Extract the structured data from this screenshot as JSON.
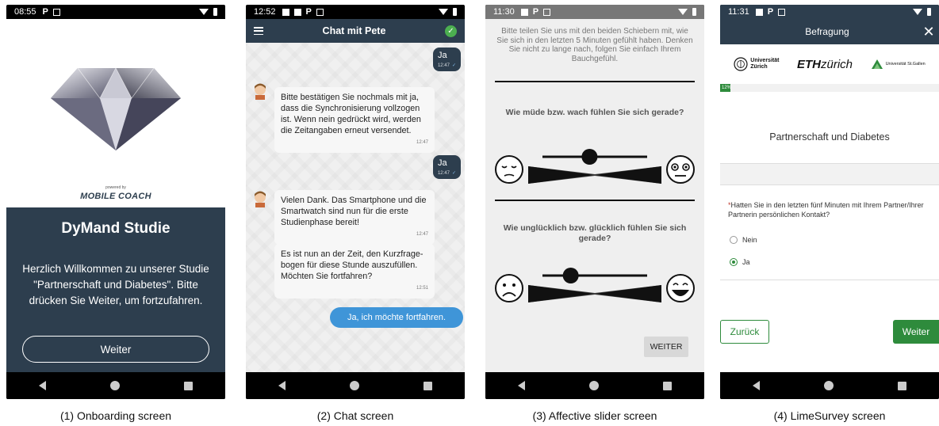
{
  "captions": [
    "(1) Onboarding screen",
    "(2) Chat screen",
    "(3) Affective slider screen",
    "(4) LimeSurvey screen"
  ],
  "onboarding": {
    "status_time": "08:55",
    "powered_by": "powered by",
    "brand": "MOBILE COACH",
    "app_title": "DyMand Studie",
    "welcome_text": "Herzlich Willkommen zu unserer Studie \"Partnerschaft und Diabetes\". Bitte drücken Sie Weiter, um fortzufahren.",
    "weiter_label": "Weiter"
  },
  "chat": {
    "status_time": "12:52",
    "title": "Chat mit Pete",
    "messages": [
      {
        "from": "user",
        "text": "Ja",
        "time": "12:47"
      },
      {
        "from": "coach",
        "text": "Bitte bestätigen Sie nochmals mit ja, dass die Synchronisierung vollzogen ist. Wenn nein gedrückt wird, werden die Zeitangaben erneut versendet.",
        "time": "12:47"
      },
      {
        "from": "user",
        "text": "Ja",
        "time": "12:47"
      },
      {
        "from": "coach",
        "text": "Vielen Dank. Das Smartphone und die Smartwatch sind nun für die erste Studienphase bereit!",
        "time": "12:47"
      },
      {
        "from": "coach",
        "text": "Es ist nun an der Zeit, den Kurzfrage-bogen für diese Stunde auszufüllen. Möchten Sie fortfahren?",
        "time": "12:51"
      }
    ],
    "reply_button": "Ja, ich möchte fortfahren."
  },
  "slider": {
    "status_time": "11:30",
    "intro": "Bitte teilen Sie uns mit den beiden Schiebern mit, wie Sie sich in den letzten 5 Minuten gefühlt haben. Denken Sie nicht zu lange nach, folgen Sie einfach Ihrem Bauchgefühl.",
    "q1": "Wie müde bzw. wach fühlen Sie sich gerade?",
    "q1_value": 0.45,
    "q2": "Wie unglücklich bzw. glücklich fühlen Sie sich gerade?",
    "q2_value": 0.27,
    "weiter_label": "WEITER"
  },
  "limesurvey": {
    "status_time": "11:31",
    "title": "Befragung",
    "logo_uzh_line1": "Universität",
    "logo_uzh_line2": "Zürich",
    "logo_eth_bold": "ETH",
    "logo_eth_light": "zürich",
    "logo_hsg": "Universität St.Gallen",
    "progress_label": "12%",
    "progress_value": 0.12,
    "group_title": "Partnerschaft und Diabetes",
    "question_required_mark": "*",
    "question": "Hatten Sie in den letzten fünf Minuten mit Ihrem Partner/Ihrer Partnerin persönlichen Kontakt?",
    "options": [
      {
        "label": "Nein",
        "selected": false
      },
      {
        "label": "Ja",
        "selected": true
      }
    ],
    "back_label": "Zurück",
    "next_label": "Weiter"
  },
  "colors": {
    "navy": "#2d3e4e",
    "chat_blue": "#3f95d8",
    "lime_green": "#2e8b3c",
    "status_check": "#4caf50"
  }
}
